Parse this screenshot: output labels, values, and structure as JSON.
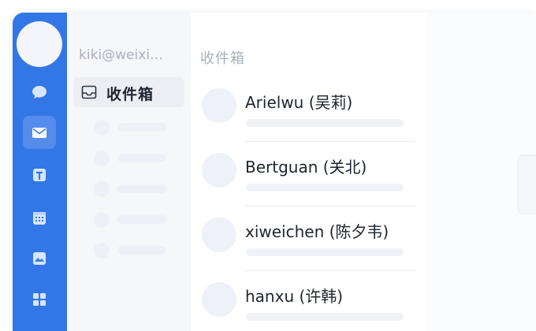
{
  "account": {
    "email": "kiki@weixi…"
  },
  "nav": {
    "items": [
      {
        "icon": "chat-bubble-icon",
        "active": false
      },
      {
        "icon": "mail-icon",
        "active": true
      },
      {
        "icon": "document-icon",
        "active": false
      },
      {
        "icon": "calendar-icon",
        "active": false
      },
      {
        "icon": "image-icon",
        "active": false
      },
      {
        "icon": "apps-grid-icon",
        "active": false
      }
    ]
  },
  "folders": {
    "selected_label": "收件箱",
    "selected_icon": "inbox-icon"
  },
  "mail_list": {
    "title": "收件箱",
    "rows": [
      {
        "sender": "Arielwu (吴莉)"
      },
      {
        "sender": "Bertguan (关北)"
      },
      {
        "sender": "xiweichen (陈夕韦)"
      },
      {
        "sender": "hanxu (许韩)"
      }
    ]
  },
  "colors": {
    "rail": "#3377e6",
    "folder_bg": "#f6f7fa",
    "text_dark": "#1e2430",
    "text_muted": "#a9afbb"
  }
}
